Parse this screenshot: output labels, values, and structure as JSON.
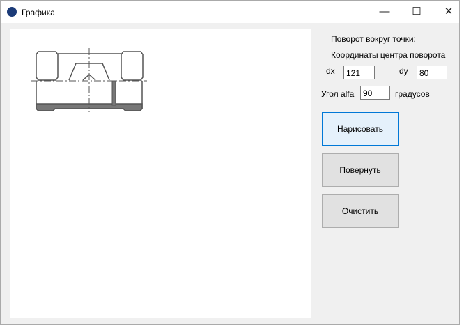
{
  "window": {
    "title": "Графика"
  },
  "panel": {
    "rotate_label": "Поворот вокруг точки:",
    "center_label": "Координаты центра поворота",
    "dx_label": "dx =",
    "dx_value": "121",
    "dy_label": "dy =",
    "dy_value": "80",
    "angle_label": "Угол alfa =",
    "angle_value": "90",
    "degrees_label": "градусов"
  },
  "buttons": {
    "draw": "Нарисовать",
    "rotate": "Повернуть",
    "clear": "Очистить"
  }
}
